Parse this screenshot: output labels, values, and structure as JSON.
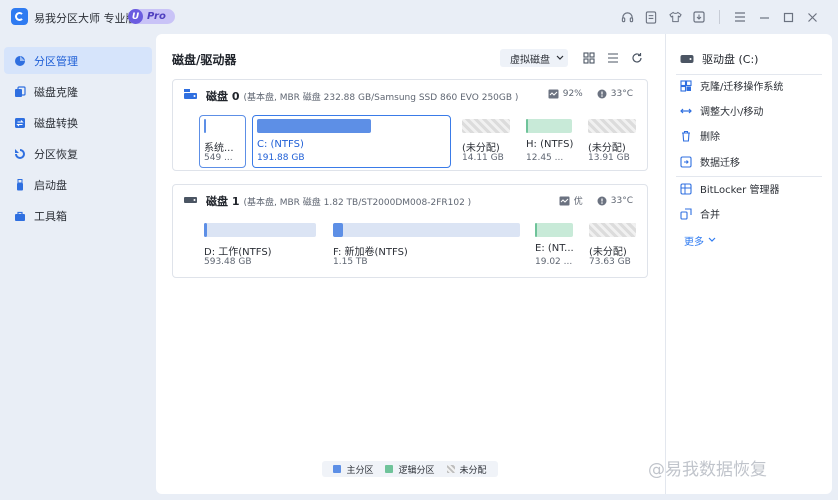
{
  "app": {
    "title": "易我分区大师 专业版",
    "badge": "Pro",
    "badge_letter": "U"
  },
  "sidebar": {
    "items": [
      {
        "label": "分区管理",
        "icon": "pie-chart-icon",
        "active": true
      },
      {
        "label": "磁盘克隆",
        "icon": "clone-icon",
        "active": false
      },
      {
        "label": "磁盘转换",
        "icon": "convert-icon",
        "active": false
      },
      {
        "label": "分区恢复",
        "icon": "recover-icon",
        "active": false
      },
      {
        "label": "启动盘",
        "icon": "usb-icon",
        "active": false
      },
      {
        "label": "工具箱",
        "icon": "toolbox-icon",
        "active": false
      }
    ]
  },
  "main": {
    "title": "磁盘/驱动器",
    "virtual_disk_label": "虚拟磁盘"
  },
  "disks": [
    {
      "name": "磁盘 0",
      "info": "(基本盘, MBR 磁盘 232.88 GB/Samsung SSD 860 EVO 250GB )",
      "health": "92%",
      "temp": "33°C",
      "partitions": [
        {
          "name": "系统...",
          "size": "549 ...",
          "type": "primary",
          "fill": 0.04,
          "selected": "thin"
        },
        {
          "name": "C: (NTFS)",
          "size": "191.88 GB",
          "type": "primary",
          "fill": 0.61,
          "selected": "thick"
        },
        {
          "name": "(未分配)",
          "size": "14.11 GB",
          "type": "unalloc",
          "fill": 0
        },
        {
          "name": "H: (NTFS)",
          "size": "12.45 ...",
          "type": "logical",
          "fill": 0.03
        },
        {
          "name": "(未分配)",
          "size": "13.91 GB",
          "type": "unalloc",
          "fill": 0
        }
      ]
    },
    {
      "name": "磁盘 1",
      "info": "(基本盘, MBR 磁盘 1.82 TB/ST2000DM008-2FR102 )",
      "health": "优",
      "temp": "33°C",
      "partitions": [
        {
          "name": "D: 工作(NTFS)",
          "size": "593.48 GB",
          "type": "primary",
          "fill": 0.02
        },
        {
          "name": "F: 新加卷(NTFS)",
          "size": "1.15 TB",
          "type": "primary",
          "fill": 0.05
        },
        {
          "name": "E: (NT...",
          "size": "19.02 ...",
          "type": "logical",
          "fill": 0.05
        },
        {
          "name": "(未分配)",
          "size": "73.63 GB",
          "type": "unalloc",
          "fill": 0
        }
      ]
    }
  ],
  "legend": {
    "primary": "主分区",
    "logical": "逻辑分区",
    "unalloc": "未分配"
  },
  "right_panel": {
    "drive_label": "驱动盘 (C:)",
    "actions": [
      {
        "label": "克隆/迁移操作系统",
        "icon": "clone-os-icon"
      },
      {
        "label": "调整大小/移动",
        "icon": "resize-icon"
      },
      {
        "label": "删除",
        "icon": "trash-icon"
      },
      {
        "label": "数据迁移",
        "icon": "data-migrate-icon"
      }
    ],
    "actions2": [
      {
        "label": "BitLocker 管理器",
        "icon": "bitlocker-icon"
      },
      {
        "label": "合并",
        "icon": "merge-icon"
      }
    ],
    "more_label": "更多"
  },
  "watermark": "@易我数据恢复",
  "colors": {
    "accent": "#2f7bf1",
    "primary_partition": "#5d8fe6",
    "logical_partition": "#6fc39a",
    "unallocated": "#dcdcdc"
  }
}
